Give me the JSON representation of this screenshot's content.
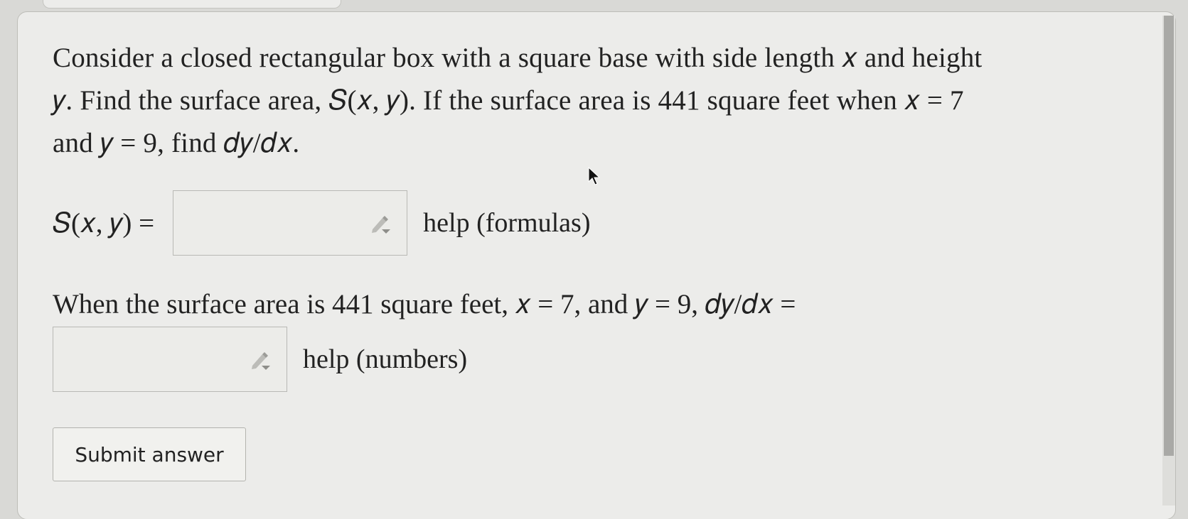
{
  "problem": {
    "line1": "Consider a closed rectangular box with a square base with side length 𝑥 and height",
    "line2": "𝑦. Find the surface area, 𝑆(𝑥, 𝑦). If the surface area is 441 square feet when 𝑥 = 7",
    "line3": "and 𝑦 = 9, find 𝑑𝑦/𝑑𝑥."
  },
  "part1": {
    "label": "𝑆(𝑥, 𝑦) =",
    "input_value": "",
    "help": "help (formulas)"
  },
  "part2": {
    "label": "When the surface area is 441 square feet, 𝑥 = 7, and 𝑦 = 9, 𝑑𝑦/𝑑𝑥 =",
    "input_value": "",
    "help": "help (numbers)"
  },
  "submit_label": "Submit answer",
  "icons": [
    "pencil-icon",
    "cursor-icon"
  ]
}
